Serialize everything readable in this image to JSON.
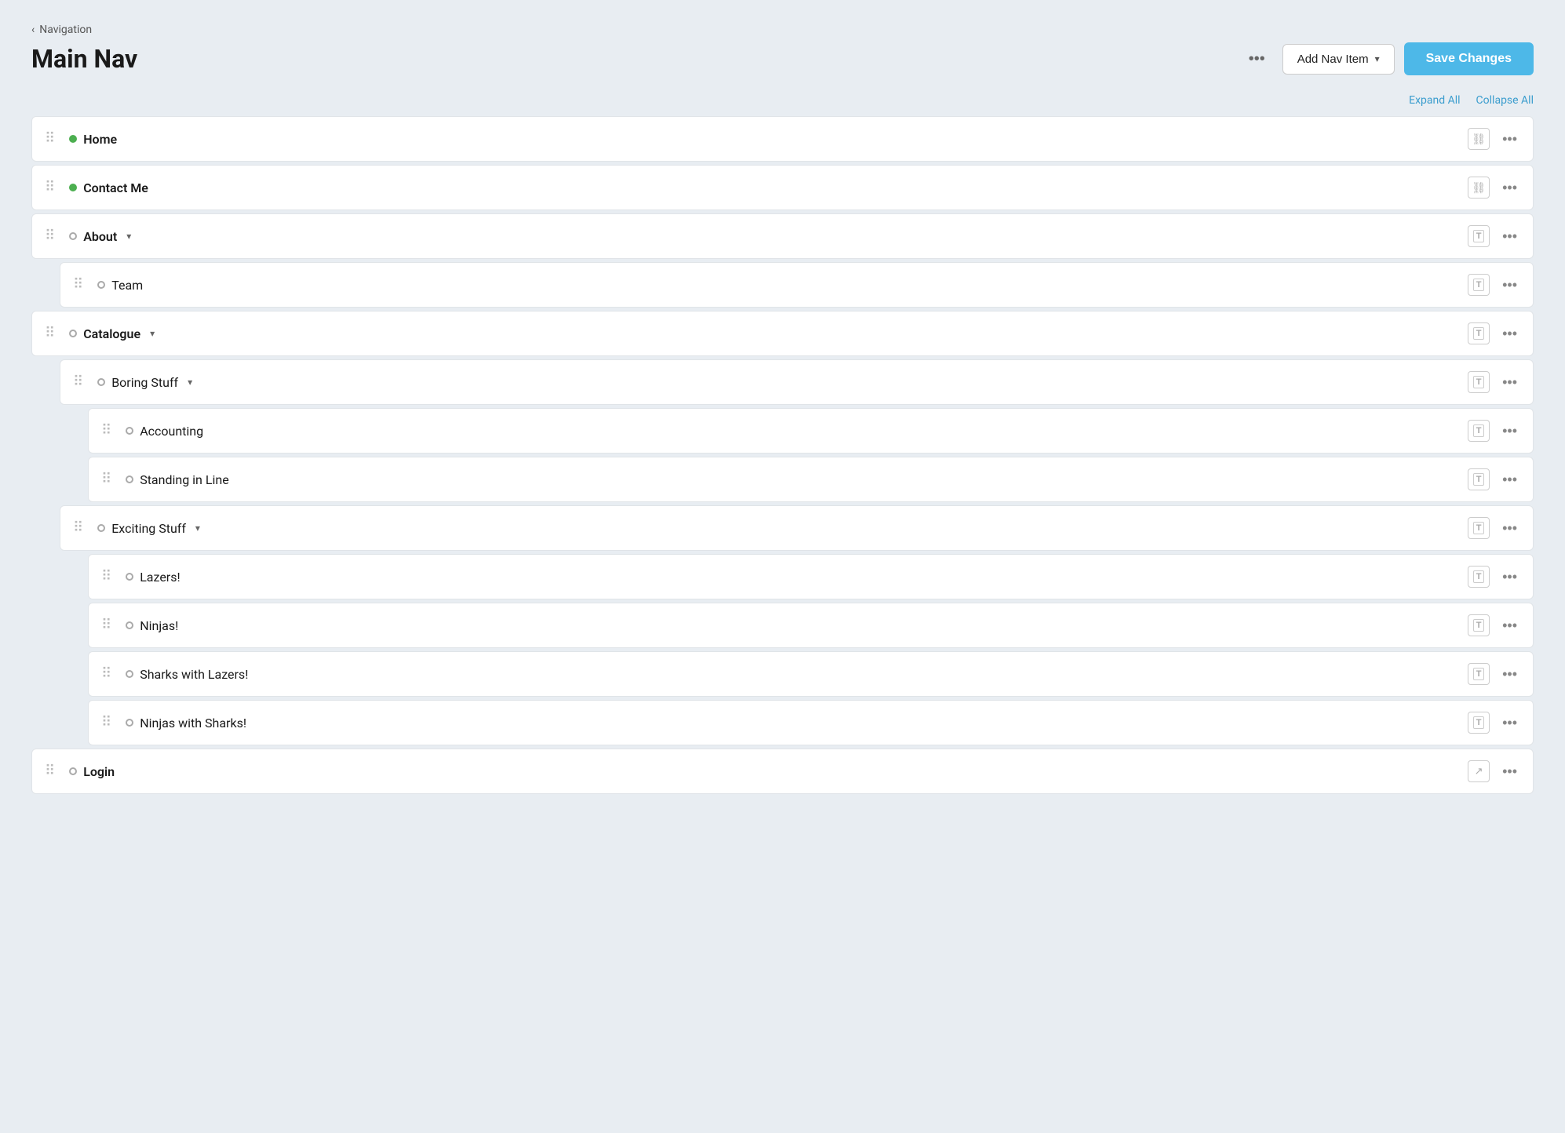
{
  "back": {
    "label": "Navigation"
  },
  "header": {
    "title": "Main Nav",
    "more_label": "•••",
    "add_nav_label": "Add Nav Item",
    "save_label": "Save Changes"
  },
  "controls": {
    "expand_all": "Expand All",
    "collapse_all": "Collapse All"
  },
  "nav_items": [
    {
      "id": "home",
      "label": "Home",
      "level": 0,
      "status": "green",
      "icon": "link",
      "has_children": false,
      "expandable": false
    },
    {
      "id": "contact-me",
      "label": "Contact Me",
      "level": 0,
      "status": "green",
      "icon": "link",
      "has_children": false,
      "expandable": false
    },
    {
      "id": "about",
      "label": "About",
      "level": 0,
      "status": "empty",
      "icon": "text",
      "has_children": true,
      "expandable": true
    },
    {
      "id": "team",
      "label": "Team",
      "level": 1,
      "status": "empty",
      "icon": "text",
      "has_children": false,
      "expandable": false
    },
    {
      "id": "catalogue",
      "label": "Catalogue",
      "level": 0,
      "status": "empty",
      "icon": "text",
      "has_children": true,
      "expandable": true
    },
    {
      "id": "boring-stuff",
      "label": "Boring Stuff",
      "level": 1,
      "status": "empty",
      "icon": "text",
      "has_children": true,
      "expandable": true
    },
    {
      "id": "accounting",
      "label": "Accounting",
      "level": 2,
      "status": "empty",
      "icon": "text",
      "has_children": false,
      "expandable": false
    },
    {
      "id": "standing-in-line",
      "label": "Standing in Line",
      "level": 2,
      "status": "empty",
      "icon": "text",
      "has_children": false,
      "expandable": false
    },
    {
      "id": "exciting-stuff",
      "label": "Exciting Stuff",
      "level": 1,
      "status": "empty",
      "icon": "text",
      "has_children": true,
      "expandable": true
    },
    {
      "id": "lazers",
      "label": "Lazers!",
      "level": 2,
      "status": "empty",
      "icon": "text",
      "has_children": false,
      "expandable": false
    },
    {
      "id": "ninjas",
      "label": "Ninjas!",
      "level": 2,
      "status": "empty",
      "icon": "text",
      "has_children": false,
      "expandable": false
    },
    {
      "id": "sharks-with-lazers",
      "label": "Sharks with Lazers!",
      "level": 2,
      "status": "empty",
      "icon": "text",
      "has_children": false,
      "expandable": false
    },
    {
      "id": "ninjas-with-sharks",
      "label": "Ninjas with Sharks!",
      "level": 2,
      "status": "empty",
      "icon": "text",
      "has_children": false,
      "expandable": false
    },
    {
      "id": "login",
      "label": "Login",
      "level": 0,
      "status": "empty",
      "icon": "external",
      "has_children": false,
      "expandable": false
    }
  ]
}
